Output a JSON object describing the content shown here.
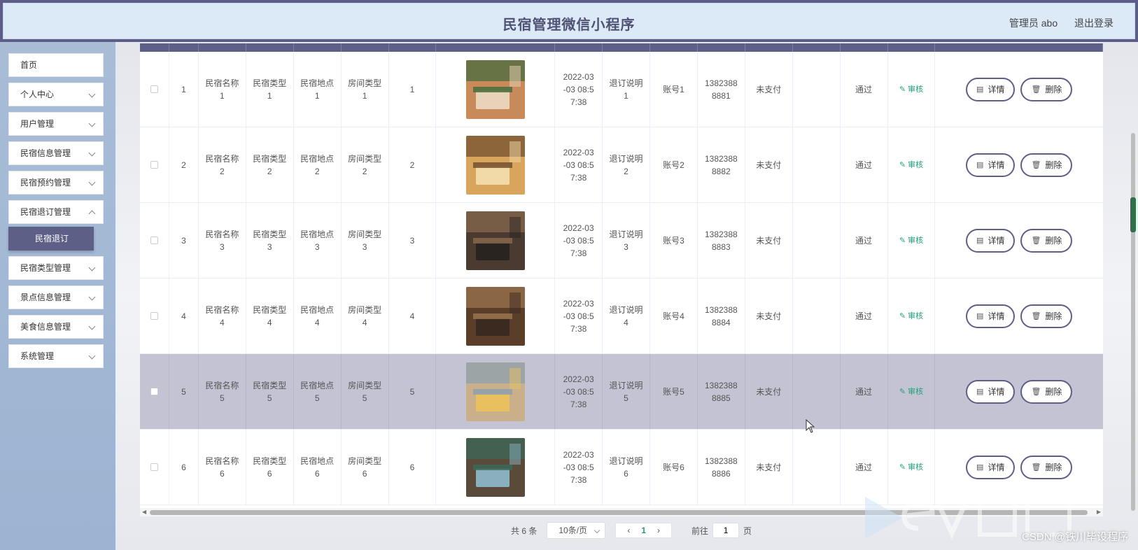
{
  "header": {
    "title": "民宿管理微信小程序",
    "user_label": "管理员 abo",
    "logout_label": "退出登录"
  },
  "sidebar": {
    "items": [
      {
        "label": "首页"
      },
      {
        "label": "个人中心"
      },
      {
        "label": "用户管理"
      },
      {
        "label": "民宿信息管理"
      },
      {
        "label": "民宿预约管理"
      },
      {
        "label": "民宿退订管理"
      },
      {
        "label": "民宿类型管理"
      },
      {
        "label": "景点信息管理"
      },
      {
        "label": "美食信息管理"
      },
      {
        "label": "系统管理"
      }
    ],
    "sub_item": "民宿退订"
  },
  "table": {
    "rows": [
      {
        "index": "1",
        "name": "民宿名称\n1",
        "type": "民宿类型\n1",
        "place": "民宿地点\n1",
        "room": "房间类型\n1",
        "num": "1",
        "time": "2022-03\n-03 08:5\n7:38",
        "note": "退订说明\n1",
        "account": "账号1",
        "phone": "1382388\n8881",
        "pay": "未支付",
        "status": "通过",
        "review": "审核",
        "detail": "详情",
        "delete": "删除"
      },
      {
        "index": "2",
        "name": "民宿名称\n2",
        "type": "民宿类型\n2",
        "place": "民宿地点\n2",
        "room": "房间类型\n2",
        "num": "2",
        "time": "2022-03\n-03 08:5\n7:38",
        "note": "退订说明\n2",
        "account": "账号2",
        "phone": "1382388\n8882",
        "pay": "未支付",
        "status": "通过",
        "review": "审核",
        "detail": "详情",
        "delete": "删除"
      },
      {
        "index": "3",
        "name": "民宿名称\n3",
        "type": "民宿类型\n3",
        "place": "民宿地点\n3",
        "room": "房间类型\n3",
        "num": "3",
        "time": "2022-03\n-03 08:5\n7:38",
        "note": "退订说明\n3",
        "account": "账号3",
        "phone": "1382388\n8883",
        "pay": "未支付",
        "status": "通过",
        "review": "审核",
        "detail": "详情",
        "delete": "删除"
      },
      {
        "index": "4",
        "name": "民宿名称\n4",
        "type": "民宿类型\n4",
        "place": "民宿地点\n4",
        "room": "房间类型\n4",
        "num": "4",
        "time": "2022-03\n-03 08:5\n7:38",
        "note": "退订说明\n4",
        "account": "账号4",
        "phone": "1382388\n8884",
        "pay": "未支付",
        "status": "通过",
        "review": "审核",
        "detail": "详情",
        "delete": "删除"
      },
      {
        "index": "5",
        "name": "民宿名称\n5",
        "type": "民宿类型\n5",
        "place": "民宿地点\n5",
        "room": "房间类型\n5",
        "num": "5",
        "time": "2022-03\n-03 08:5\n7:38",
        "note": "退订说明\n5",
        "account": "账号5",
        "phone": "1382388\n8885",
        "pay": "未支付",
        "status": "通过",
        "review": "审核",
        "detail": "详情",
        "delete": "删除"
      },
      {
        "index": "6",
        "name": "民宿名称\n6",
        "type": "民宿类型\n6",
        "place": "民宿地点\n6",
        "room": "房间类型\n6",
        "num": "6",
        "time": "2022-03\n-03 08:5\n7:38",
        "note": "退订说明\n6",
        "account": "账号6",
        "phone": "1382388\n8886",
        "pay": "未支付",
        "status": "通过",
        "review": "审核",
        "detail": "详情",
        "delete": "删除"
      }
    ],
    "highlighted_row": 5
  },
  "pagination": {
    "total": "共 6 条",
    "page_size": "10条/页",
    "current_page": "1",
    "goto_prefix": "前往",
    "goto_value": "1",
    "goto_suffix": "页"
  },
  "watermark": {
    "csdn": "CSDN @铁川毕设程序"
  },
  "colors": {
    "header_bar": "#5c5e87",
    "header_panel": "#dbeaf6",
    "sidebar": "#a8bcd6",
    "accent": "#5d5f86",
    "review_green": "#2a9c7c",
    "highlight_row": "#c3c3d4"
  }
}
